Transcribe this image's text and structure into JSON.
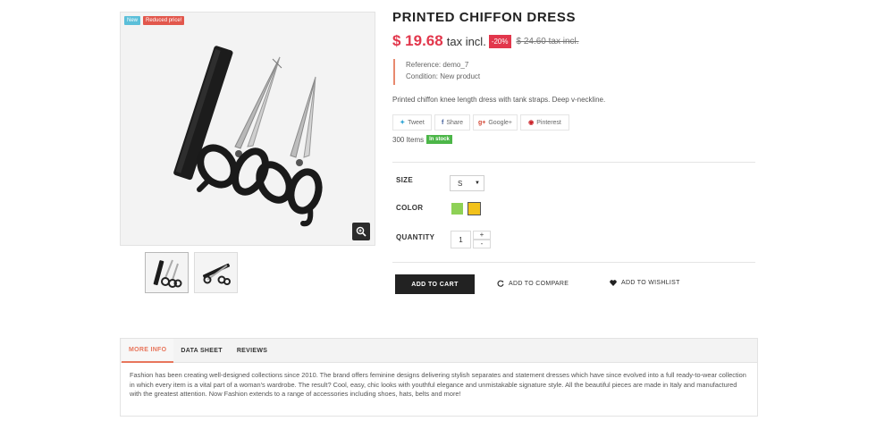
{
  "product": {
    "title": "PRINTED CHIFFON DRESS",
    "badges": {
      "new": "New",
      "reduced": "Reduced price!"
    },
    "price_current": "$ 19.68",
    "price_tax": "tax incl.",
    "discount": "-20%",
    "price_old": "$ 24.60 tax incl.",
    "reference": "Reference: demo_7",
    "condition": "Condition: New product",
    "description": "Printed chiffon knee length dress with tank straps. Deep v-neckline.",
    "stock_count": "300 Items",
    "stock_status": "In stock"
  },
  "share": {
    "tweet": "Tweet",
    "share": "Share",
    "google": "Google+",
    "pinterest": "Pinterest"
  },
  "options": {
    "size_label": "SIZE",
    "size_value": "S",
    "color_label": "COLOR",
    "colors": [
      "#8ed156",
      "#f2c21b"
    ],
    "quantity_label": "QUANTITY",
    "quantity_value": "1",
    "qty_up": "+",
    "qty_down": "-"
  },
  "actions": {
    "add_to_cart": "ADD TO CART",
    "add_to_compare": "ADD TO COMPARE",
    "add_to_wishlist": "ADD TO WISHLIST"
  },
  "tabs": {
    "items": [
      "MORE INFO",
      "DATA SHEET",
      "REVIEWS"
    ],
    "content": "Fashion has been creating well-designed collections since 2010. The brand offers feminine designs delivering stylish separates and statement dresses which have since evolved into a full ready-to-wear collection in which every item is a vital part of a woman's wardrobe. The result? Cool, easy, chic looks with youthful elegance and unmistakable signature style. All the beautiful pieces are made in Italy and manufactured with the greatest attention. Now Fashion extends to a range of accessories including shoes, hats, belts and more!"
  },
  "colors": {
    "price": "#e2374c",
    "accent": "#e8765c",
    "in_stock": "#4cb648",
    "badge_new": "#5bbfd9",
    "badge_reduced": "#e2574c"
  },
  "icons": {
    "zoom": "zoom-in-icon",
    "twitter": "twitter-icon",
    "facebook": "facebook-icon",
    "google": "google-plus-icon",
    "pinterest": "pinterest-icon",
    "compare": "refresh-icon",
    "wishlist": "heart-icon",
    "select": "caret-down-icon"
  }
}
